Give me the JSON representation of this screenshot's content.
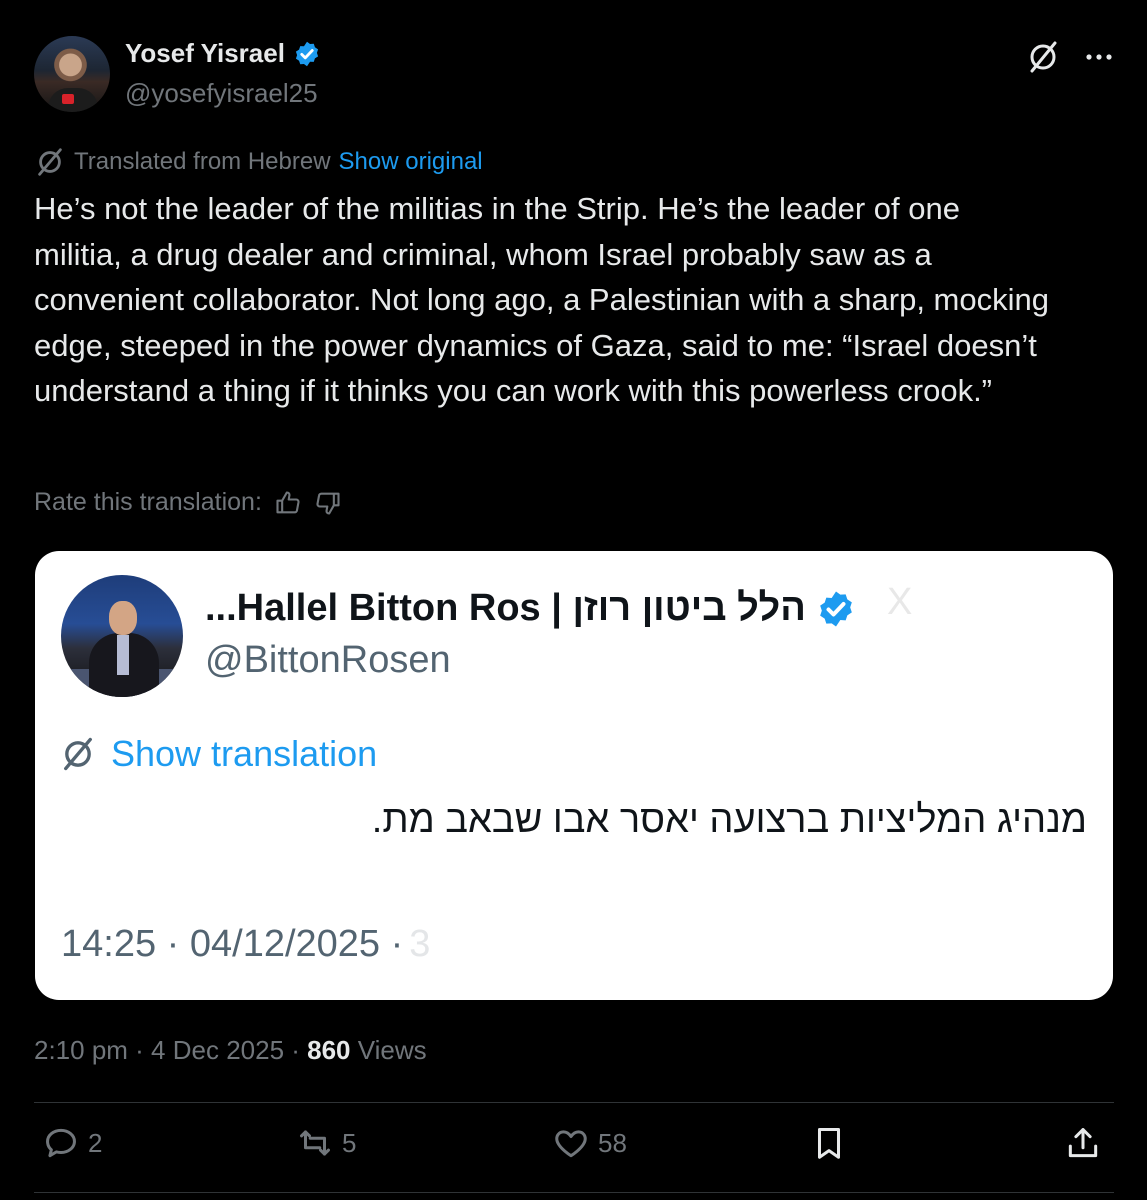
{
  "author": {
    "name": "Yosef Yisrael",
    "handle": "@yosefyisrael25",
    "verified": true
  },
  "translation_bar": {
    "note": "Translated from Hebrew",
    "show_original": "Show original"
  },
  "post_text": "He’s not the leader of the militias in the Strip. He’s the leader of one militia, a drug dealer and criminal, whom Israel probably saw as a convenient collaborator. Not long ago, a Palestinian with a sharp, mocking edge, steeped in the power dynamics of Gaza, said to me: “Israel doesn’t understand a thing if it thinks you can work with this powerless crook.”",
  "rate": {
    "label": "Rate this translation:"
  },
  "quoted": {
    "name": "...Hallel Bitton Ros | הלל ביטון רוזן",
    "faded_text": "X",
    "handle": "@BittonRosen",
    "show_translation": "Show translation",
    "text": "מנהיג המליציות ברצועה יאסר אבו שבאב מת.",
    "time": "14:25 · 04/12/2025 ·",
    "time_faded": "3"
  },
  "meta": {
    "time": "2:10 pm · 4 Dec 2025 · ",
    "views_count": "860",
    "views_label": " Views"
  },
  "actions": {
    "replies": "2",
    "reposts": "5",
    "likes": "58"
  },
  "colors": {
    "background": "#000000",
    "text": "#e7e9ea",
    "muted": "#71767b",
    "link": "#1d9bf0",
    "verified": "#1d9bf0"
  },
  "icons": [
    "grok-icon",
    "more-icon",
    "translate-icon",
    "thumbs-up-icon",
    "thumbs-down-icon",
    "verified-badge-icon",
    "reply-icon",
    "repost-icon",
    "like-icon",
    "bookmark-icon",
    "share-icon"
  ]
}
